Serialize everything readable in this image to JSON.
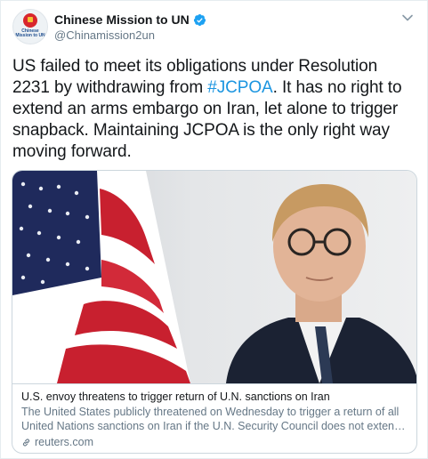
{
  "author": {
    "display_name": "Chinese Mission to UN",
    "handle": "@Chinamission2un",
    "avatar_label": "Chinese Mission to UN",
    "verified": true
  },
  "tweet": {
    "text_part1": "US failed to meet its obligations under Resolution 2231 by withdrawing from ",
    "hashtag": "#JCPOA",
    "text_part2": ". It has no right to extend an arms embargo on Iran, let alone to trigger snapback. Maintaining JCPOA is the only right way moving forward."
  },
  "card": {
    "title": "U.S. envoy threatens to trigger return of U.N. sanctions on Iran",
    "description_line1": "The United States publicly threatened on Wednesday to trigger a return of all",
    "description_line2": "United Nations sanctions on Iran if the U.N. Security Council does not extend an ...",
    "domain": "reuters.com"
  },
  "colors": {
    "link": "#1b95e0",
    "verified": "#1da1f2",
    "secondary_text": "#657786",
    "border": "#ccd6dd"
  },
  "icons": {
    "verified": "verified-badge-icon",
    "caret": "chevron-down-icon",
    "link": "link-icon"
  }
}
